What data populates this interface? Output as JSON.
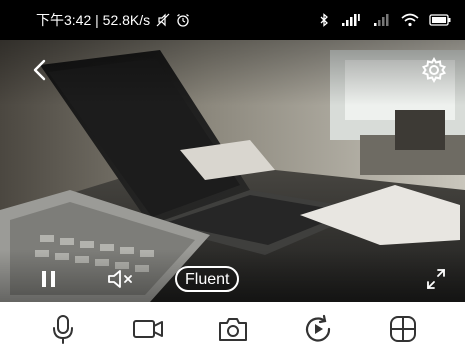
{
  "status_bar": {
    "left_text": "下午3:42 | 52.8K/s",
    "icons_left": [
      "silent-icon",
      "alarm-icon"
    ],
    "icons_right": [
      "bluetooth-icon",
      "signal-hd-icon",
      "signal-icon",
      "wifi-icon",
      "battery-icon"
    ]
  },
  "video": {
    "quality_label": "Fluent",
    "icons": [
      "back-icon",
      "gear-icon",
      "pause-icon",
      "mute-icon",
      "fullscreen-icon"
    ]
  },
  "toolbar": {
    "items": [
      {
        "name": "talk",
        "icon": "microphone-icon"
      },
      {
        "name": "record",
        "icon": "video-camera-icon"
      },
      {
        "name": "snapshot",
        "icon": "camera-icon"
      },
      {
        "name": "playback",
        "icon": "replay-icon"
      },
      {
        "name": "more",
        "icon": "grid-icon"
      }
    ]
  },
  "colors": {
    "status_bg": "#000000",
    "icon_dark": "#333333",
    "overlay_white": "#ffffff"
  }
}
